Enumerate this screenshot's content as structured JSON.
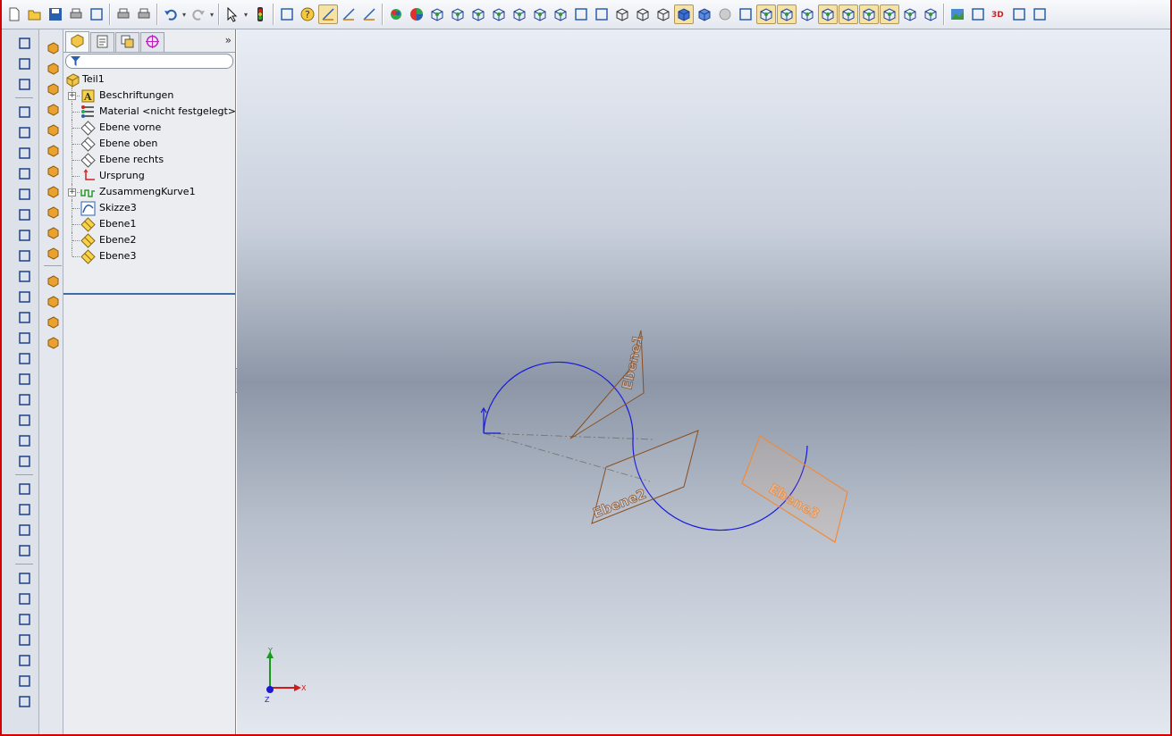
{
  "app": {
    "title": "Teil1"
  },
  "toolbar": {
    "icons": [
      "new-icon",
      "open-icon",
      "save-icon",
      "print-setup-icon",
      "rebuild-icon",
      "print-icon",
      "print-preview-icon",
      "undo-icon",
      "redo-icon",
      "select-icon",
      "traffic-light-icon",
      "properties-icon",
      "help-icon",
      "sketch-icon",
      "smart-dimension-icon",
      "edit-sketch-icon",
      "appearance-icon",
      "color-icon",
      "view-front-icon",
      "view-back-icon",
      "view-left-icon",
      "view-right-icon",
      "view-top-icon",
      "view-bottom-icon",
      "view-iso-icon",
      "normal-to-icon",
      "section-view-icon",
      "wireframe-icon",
      "hidden-lines-visible-icon",
      "hidden-lines-removed-icon",
      "shaded-with-edges-icon",
      "shaded-icon",
      "realview-icon",
      "shadows-icon",
      "view-planes-icon",
      "view-axes-icon",
      "view-origins-icon",
      "view-coordinate-icon",
      "view-points-icon",
      "view-curves-icon",
      "view-sketches-icon",
      "view-dimensions-icon",
      "view-relations-icon",
      "render-icon",
      "photoworks-icon",
      "3d-content-icon",
      "toolbox-icon",
      "dimxpert-icon"
    ]
  },
  "feature_manager": {
    "tabs": [
      "feature-tree-tab",
      "property-manager-tab",
      "configuration-manager-tab",
      "dimxpert-tab"
    ],
    "root": {
      "label": "Teil1",
      "icon": "part-icon"
    },
    "items": [
      {
        "label": "Beschriftungen",
        "icon": "annotations-icon",
        "expandable": true
      },
      {
        "label": "Material <nicht festgelegt>",
        "icon": "material-icon",
        "expandable": false
      },
      {
        "label": "Ebene vorne",
        "icon": "plane-icon",
        "expandable": false
      },
      {
        "label": "Ebene oben",
        "icon": "plane-icon",
        "expandable": false
      },
      {
        "label": "Ebene rechts",
        "icon": "plane-icon",
        "expandable": false
      },
      {
        "label": "Ursprung",
        "icon": "origin-icon",
        "expandable": false
      },
      {
        "label": "ZusammengKurve1",
        "icon": "composite-curve-icon",
        "expandable": true
      },
      {
        "label": "Skizze3",
        "icon": "sketch-icon",
        "expandable": false
      },
      {
        "label": "Ebene1",
        "icon": "ref-plane-icon",
        "expandable": false
      },
      {
        "label": "Ebene2",
        "icon": "ref-plane-icon",
        "expandable": false
      },
      {
        "label": "Ebene3",
        "icon": "ref-plane-icon",
        "expandable": false
      }
    ]
  },
  "viewport": {
    "plane_labels": {
      "ebene1": "Ebene1",
      "ebene2": "Ebene2",
      "ebene3": "Ebene3"
    },
    "triad": {
      "x": "X",
      "y": "Y",
      "z": "Z"
    },
    "colors": {
      "curve": "#1a1ad9",
      "plane": "#8a4f22",
      "plane_selected": "#f08a3a",
      "triad_x": "#d41a1a",
      "triad_y": "#1a9a1a",
      "triad_z": "#1a1ad0"
    }
  }
}
